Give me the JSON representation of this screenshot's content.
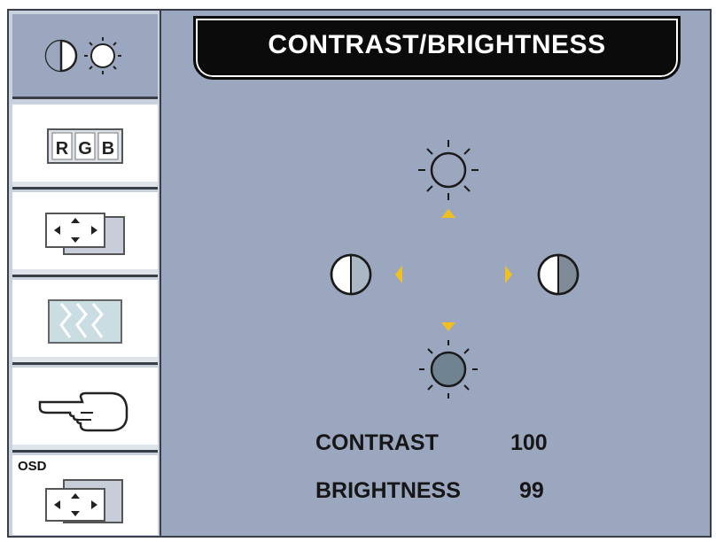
{
  "header": {
    "title": "CONTRAST/BRIGHTNESS"
  },
  "sidebar": {
    "items": [
      {
        "id": "contrast-brightness",
        "icon": "contrast-brightness-icon"
      },
      {
        "id": "rgb",
        "label": "RGB",
        "letters": [
          "R",
          "G",
          "B"
        ],
        "icon": "rgb-icon"
      },
      {
        "id": "position",
        "icon": "position-icon"
      },
      {
        "id": "noise",
        "icon": "wave-icon"
      },
      {
        "id": "pointer",
        "icon": "hand-pointer-icon"
      },
      {
        "id": "osd",
        "label": "OSD",
        "icon": "osd-position-icon"
      }
    ]
  },
  "main": {
    "readouts": [
      {
        "label": "CONTRAST",
        "value": "100"
      },
      {
        "label": "BRIGHTNESS",
        "value": "99"
      }
    ]
  },
  "colors": {
    "panel": "#9aa7bf",
    "arrow": "#f2c01e",
    "title_bar": "#0b0b0b"
  }
}
